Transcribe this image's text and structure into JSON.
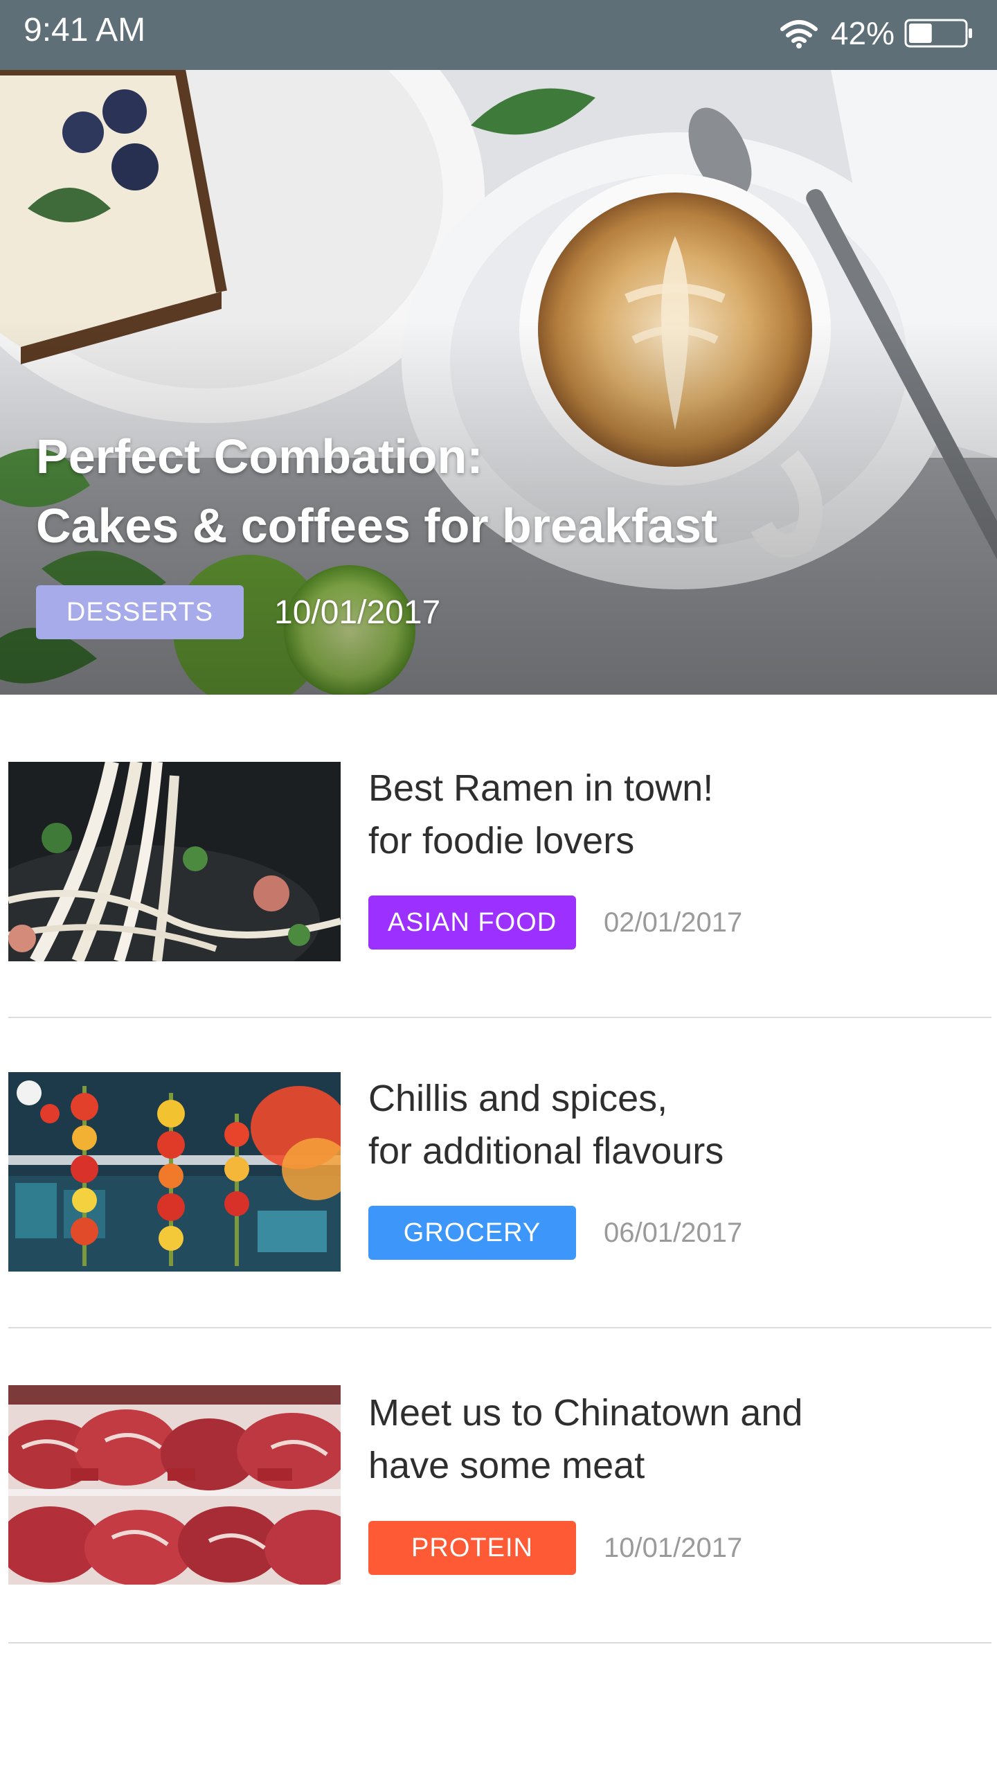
{
  "status_bar": {
    "time": "9:41 AM",
    "battery_percent": "42%",
    "battery_level": 0.42,
    "icons": [
      "wifi-icon",
      "battery-icon"
    ]
  },
  "hero": {
    "title_line1": "Perfect Combation:",
    "title_line2": "Cakes & coffees for breakfast",
    "tag": "DESSERTS",
    "tag_color": "#a7abe9",
    "date": "10/01/2017"
  },
  "articles": [
    {
      "title_line1": "Best Ramen in town!",
      "title_line2": "for foodie lovers",
      "tag": "ASIAN FOOD",
      "tag_color": "#9b30ff",
      "date": "02/01/2017"
    },
    {
      "title_line1": "Chillis and spices,",
      "title_line2": "for additional flavours",
      "tag": "GROCERY",
      "tag_color": "#3d97fb",
      "date": "06/01/2017"
    },
    {
      "title_line1": "Meet us to Chinatown and",
      "title_line2": "have some meat",
      "tag": "PROTEIN",
      "tag_color": "#ff5a36",
      "date": "10/01/2017"
    }
  ]
}
